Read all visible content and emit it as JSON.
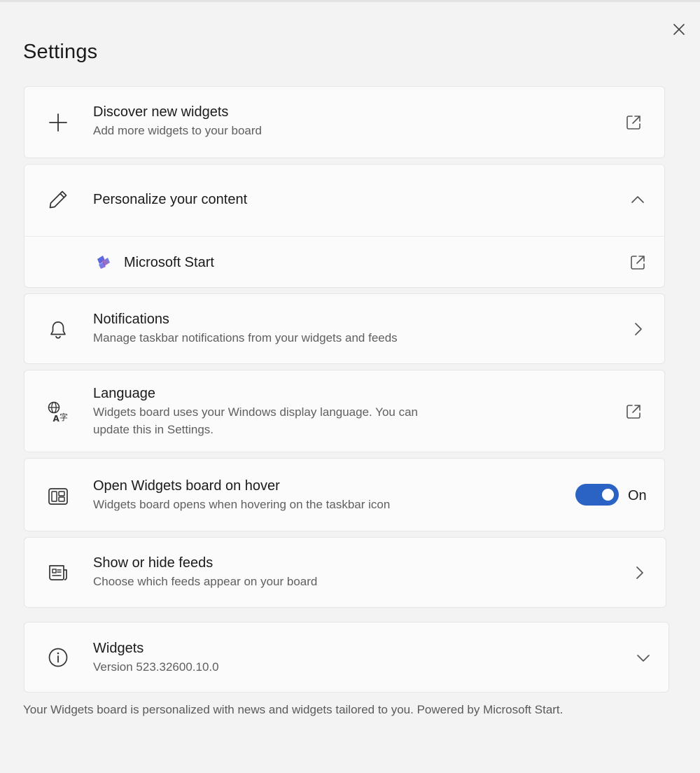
{
  "title": "Settings",
  "colors": {
    "accent": "#2a63c4",
    "card": "#fbfbfb",
    "background": "#f3f3f3"
  },
  "close": {
    "icon": "close-icon"
  },
  "discover": {
    "icon": "plus-icon",
    "label": "Discover new widgets",
    "desc": "Add more widgets to your board",
    "action_icon": "open-external-icon"
  },
  "personalize": {
    "icon": "pencil-icon",
    "label": "Personalize your content",
    "action_icon": "chevron-up-icon",
    "expanded": true,
    "items": [
      {
        "label": "Microsoft Start",
        "icon": "microsoft-start-logo-icon",
        "action_icon": "open-external-icon"
      }
    ]
  },
  "notifications": {
    "icon": "bell-icon",
    "label": "Notifications",
    "desc": "Manage taskbar notifications from your widgets and feeds",
    "action_icon": "chevron-right-icon"
  },
  "language": {
    "icon": "language-icon",
    "label": "Language",
    "desc": "Widgets board uses your Windows display language. You can update this in Settings.",
    "action_icon": "open-external-icon"
  },
  "hover": {
    "icon": "widgets-board-icon",
    "label": "Open Widgets board on hover",
    "desc": "Widgets board opens when hovering on the taskbar icon",
    "toggle_on": true,
    "toggle_label": "On"
  },
  "feeds": {
    "icon": "news-feed-icon",
    "label": "Show or hide feeds",
    "desc": "Choose which feeds appear on your board",
    "action_icon": "chevron-right-icon"
  },
  "about": {
    "icon": "info-icon",
    "label": "Widgets",
    "desc": "Version 523.32600.10.0",
    "action_icon": "chevron-down-icon"
  },
  "footer": "Your Widgets board is personalized with news and widgets tailored to you. Powered by Microsoft Start."
}
